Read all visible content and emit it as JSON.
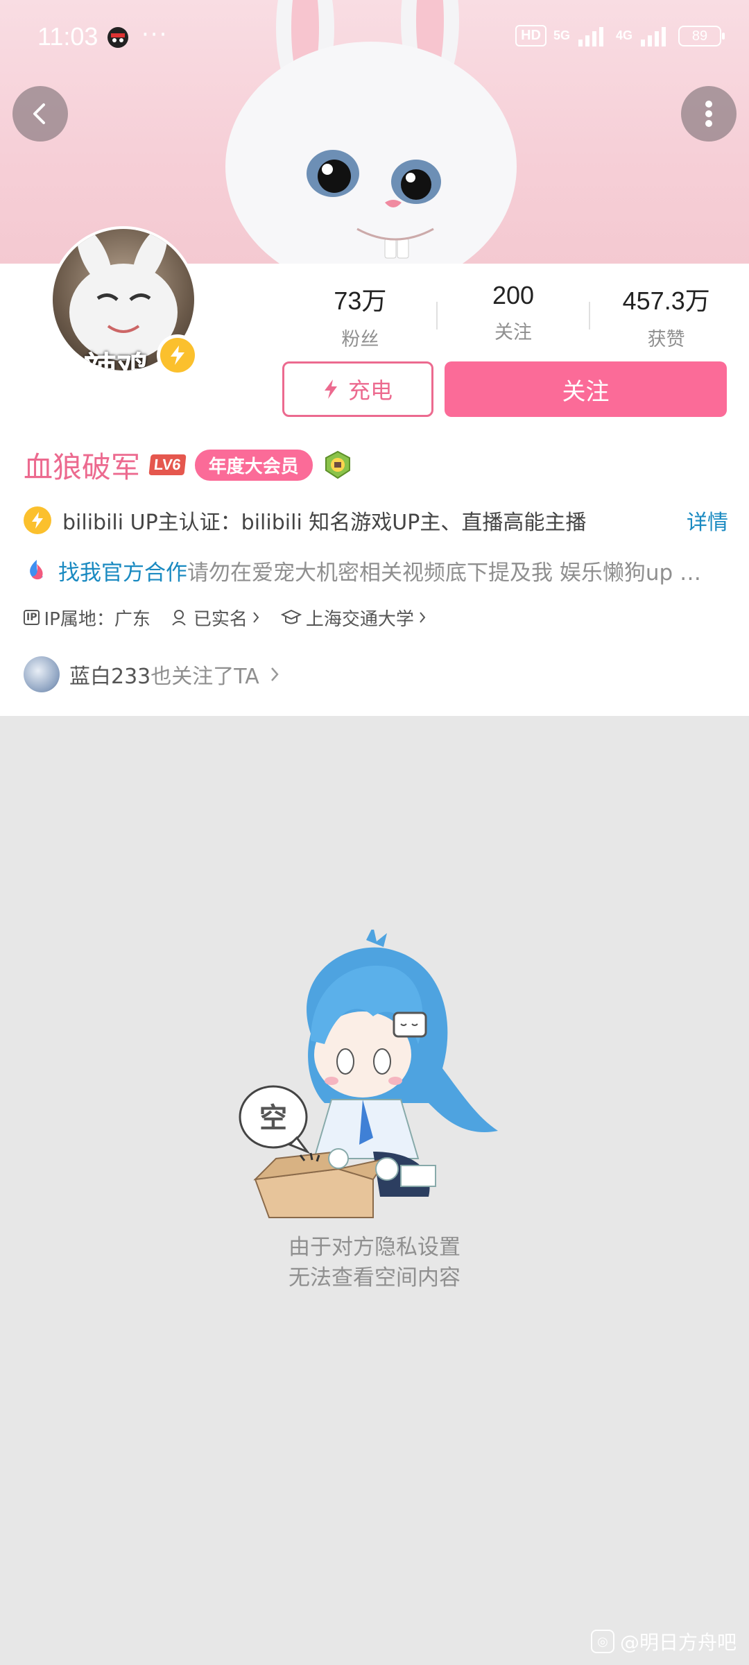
{
  "status_bar": {
    "time": "11:03",
    "dots": "···",
    "hd_label": "HD",
    "net1": "5G",
    "net2": "4G",
    "battery": "89"
  },
  "profile": {
    "avatar_text": "辣鸡",
    "stats": [
      {
        "value": "73万",
        "label": "粉丝"
      },
      {
        "value": "200",
        "label": "关注"
      },
      {
        "value": "457.3万",
        "label": "获赞"
      }
    ],
    "charge_label": "充电",
    "follow_label": "关注",
    "username": "血狼破军",
    "level": "LV6",
    "vip_label": "年度大会员",
    "verify_text": "bilibili UP主认证：bilibili 知名游戏UP主、直播高能主播",
    "verify_link": "详情",
    "intro_link": "找我官方合作",
    "intro_text": "请勿在爱宠大机密相关视频底下提及我 娱乐懒狗up …",
    "meta": {
      "ip": "IP属地：广东",
      "realname": "已实名",
      "school": "上海交通大学"
    },
    "mutual": {
      "name": "蓝白233",
      "text": "也关注了TA"
    }
  },
  "empty_state": {
    "bubble_text": "空",
    "line1": "由于对方隐私设置",
    "line2": "无法查看空间内容"
  },
  "watermark": {
    "text": "@明日方舟吧"
  },
  "colors": {
    "accent_pink": "#fb6b98",
    "link_blue": "#1a8ac1",
    "gold": "#fbc02d"
  }
}
